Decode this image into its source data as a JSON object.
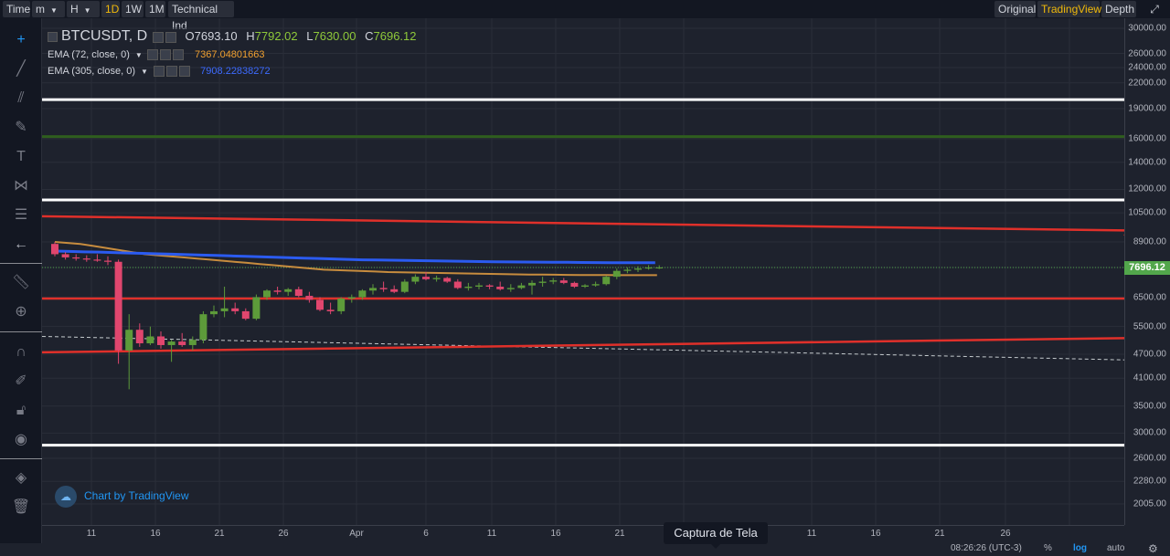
{
  "toolbar": {
    "time_label": "Time",
    "minutes_label": "m",
    "hours_label": "H",
    "day_label": "1D",
    "week_label": "1W",
    "month_label": "1M",
    "indicators_label": "Technical Ind",
    "original_label": "Original",
    "tradingview_label": "TradingView",
    "depth_label": "Depth"
  },
  "legend": {
    "symbol": "BTCUSDT, D",
    "open_label": "O",
    "open_value": "7693.10",
    "high_label": "H",
    "high_value": "7792.02",
    "low_label": "L",
    "low_value": "7630.00",
    "close_label": "C",
    "close_value": "7696.12",
    "ema1_label": "EMA (72, close, 0)",
    "ema1_value": "7367.04801663",
    "ema2_label": "EMA (305, close, 0)",
    "ema2_value": "7908.22838272"
  },
  "colors": {
    "up": "#5d9b3a",
    "down": "#e0466e",
    "ema72": "#c78c3e",
    "ema305": "#2b5bf0",
    "trendline": "#e0302a",
    "hline_white": "#ffffff",
    "hline_green": "#2f5e1e",
    "open_value": "#d1d4dc",
    "accent": "#f0b90b"
  },
  "price_axis": {
    "labels": [
      "30000.00",
      "26000.00",
      "24000.00",
      "22000.00",
      "19000.00",
      "16000.00",
      "14000.00",
      "12000.00",
      "10500.00",
      "8900.00",
      "7696.12",
      "6500.00",
      "5500.00",
      "4700.00",
      "4100.00",
      "3500.00",
      "3000.00",
      "2600.00",
      "2280.00",
      "2005.00"
    ],
    "current_price": "7696.12"
  },
  "time_axis": {
    "labels": [
      "11",
      "16",
      "21",
      "26",
      "Apr",
      "6",
      "11",
      "16",
      "21",
      "6",
      "11",
      "16",
      "21",
      "26"
    ]
  },
  "watermark": "Chart by TradingView",
  "tooltip": "Captura de Tela",
  "bottom": {
    "clock": "08:26:26 (UTC-3)",
    "percent": "%",
    "log": "log",
    "auto": "auto"
  },
  "tools": [
    "crosshair-icon",
    "trendline-icon",
    "fib-icon",
    "brush-icon",
    "text-icon",
    "pattern-icon",
    "prediction-icon",
    "back-arrow-icon",
    "ruler-icon",
    "zoom-in-icon",
    "magnet-icon",
    "lock-drawing-icon",
    "unlock-icon",
    "eye-icon",
    "layers-icon",
    "trash-icon"
  ],
  "chart_data": {
    "type": "candlestick",
    "interval": "D",
    "scale": "log",
    "candles": [
      {
        "o": 8800,
        "h": 8900,
        "l": 8200,
        "c": 8300
      },
      {
        "o": 8300,
        "h": 8400,
        "l": 8050,
        "c": 8150
      },
      {
        "o": 8150,
        "h": 8300,
        "l": 8000,
        "c": 8100
      },
      {
        "o": 8100,
        "h": 8250,
        "l": 7950,
        "c": 8050
      },
      {
        "o": 8050,
        "h": 8300,
        "l": 7950,
        "c": 8000
      },
      {
        "o": 8000,
        "h": 8200,
        "l": 7800,
        "c": 7950
      },
      {
        "o": 7950,
        "h": 8050,
        "l": 4450,
        "c": 4800
      },
      {
        "o": 4800,
        "h": 5900,
        "l": 3850,
        "c": 5400
      },
      {
        "o": 5400,
        "h": 5600,
        "l": 4900,
        "c": 5000
      },
      {
        "o": 5000,
        "h": 5500,
        "l": 4950,
        "c": 5200
      },
      {
        "o": 5200,
        "h": 5350,
        "l": 4850,
        "c": 4950
      },
      {
        "o": 4950,
        "h": 5100,
        "l": 4500,
        "c": 5050
      },
      {
        "o": 5050,
        "h": 5300,
        "l": 4900,
        "c": 4950
      },
      {
        "o": 4950,
        "h": 5200,
        "l": 4800,
        "c": 5100
      },
      {
        "o": 5100,
        "h": 6000,
        "l": 5000,
        "c": 5900
      },
      {
        "o": 5900,
        "h": 6200,
        "l": 5800,
        "c": 6000
      },
      {
        "o": 6000,
        "h": 6900,
        "l": 5800,
        "c": 6100
      },
      {
        "o": 6100,
        "h": 6300,
        "l": 5900,
        "c": 6000
      },
      {
        "o": 6000,
        "h": 6100,
        "l": 5700,
        "c": 5750
      },
      {
        "o": 5750,
        "h": 6600,
        "l": 5700,
        "c": 6500
      },
      {
        "o": 6500,
        "h": 6800,
        "l": 6400,
        "c": 6750
      },
      {
        "o": 6750,
        "h": 6900,
        "l": 6600,
        "c": 6700
      },
      {
        "o": 6700,
        "h": 6850,
        "l": 6550,
        "c": 6800
      },
      {
        "o": 6800,
        "h": 6900,
        "l": 6500,
        "c": 6550
      },
      {
        "o": 6550,
        "h": 6700,
        "l": 6300,
        "c": 6400
      },
      {
        "o": 6400,
        "h": 6500,
        "l": 6000,
        "c": 6050
      },
      {
        "o": 6050,
        "h": 6300,
        "l": 5900,
        "c": 6000
      },
      {
        "o": 6000,
        "h": 6500,
        "l": 5900,
        "c": 6450
      },
      {
        "o": 6450,
        "h": 6600,
        "l": 6300,
        "c": 6500
      },
      {
        "o": 6500,
        "h": 6800,
        "l": 6400,
        "c": 6750
      },
      {
        "o": 6750,
        "h": 7000,
        "l": 6600,
        "c": 6850
      },
      {
        "o": 6850,
        "h": 7100,
        "l": 6700,
        "c": 6800
      },
      {
        "o": 6800,
        "h": 6950,
        "l": 6650,
        "c": 6700
      },
      {
        "o": 6700,
        "h": 7200,
        "l": 6650,
        "c": 7100
      },
      {
        "o": 7100,
        "h": 7400,
        "l": 7000,
        "c": 7300
      },
      {
        "o": 7300,
        "h": 7500,
        "l": 7150,
        "c": 7200
      },
      {
        "o": 7200,
        "h": 7350,
        "l": 7100,
        "c": 7250
      },
      {
        "o": 7250,
        "h": 7300,
        "l": 7050,
        "c": 7100
      },
      {
        "o": 7100,
        "h": 7200,
        "l": 6800,
        "c": 6850
      },
      {
        "o": 6850,
        "h": 7050,
        "l": 6750,
        "c": 6900
      },
      {
        "o": 6900,
        "h": 7050,
        "l": 6800,
        "c": 6950
      },
      {
        "o": 6950,
        "h": 7000,
        "l": 6800,
        "c": 6900
      },
      {
        "o": 6900,
        "h": 7100,
        "l": 6750,
        "c": 6800
      },
      {
        "o": 6800,
        "h": 7000,
        "l": 6700,
        "c": 6850
      },
      {
        "o": 6850,
        "h": 7050,
        "l": 6800,
        "c": 6950
      },
      {
        "o": 6950,
        "h": 7150,
        "l": 6600,
        "c": 7050
      },
      {
        "o": 7050,
        "h": 7300,
        "l": 6900,
        "c": 7100
      },
      {
        "o": 7100,
        "h": 7250,
        "l": 7000,
        "c": 7150
      },
      {
        "o": 7150,
        "h": 7250,
        "l": 7000,
        "c": 7050
      },
      {
        "o": 7050,
        "h": 7100,
        "l": 6850,
        "c": 6900
      },
      {
        "o": 6900,
        "h": 7000,
        "l": 6850,
        "c": 6950
      },
      {
        "o": 6950,
        "h": 7100,
        "l": 6900,
        "c": 7000
      },
      {
        "o": 7000,
        "h": 7350,
        "l": 6950,
        "c": 7300
      },
      {
        "o": 7300,
        "h": 7650,
        "l": 7200,
        "c": 7550
      },
      {
        "o": 7550,
        "h": 7700,
        "l": 7450,
        "c": 7600
      },
      {
        "o": 7600,
        "h": 7750,
        "l": 7500,
        "c": 7650
      },
      {
        "o": 7650,
        "h": 7800,
        "l": 7600,
        "c": 7693
      },
      {
        "o": 7693.1,
        "h": 7792.02,
        "l": 7630,
        "c": 7696.12
      }
    ],
    "ema72": [
      8900,
      8850,
      8800,
      8700,
      8600,
      8500,
      8400,
      8300,
      8250,
      8200,
      8150,
      8100,
      8050,
      8000,
      7950,
      7900,
      7850,
      7800,
      7750,
      7700,
      7650,
      7600,
      7580,
      7560,
      7540,
      7520,
      7500,
      7490,
      7480,
      7470,
      7460,
      7450,
      7440,
      7430,
      7420,
      7410,
      7400,
      7395,
      7390,
      7385,
      7380,
      7375,
      7372,
      7370,
      7368,
      7367,
      7367,
      7367
    ],
    "ema305": [
      8450,
      8430,
      8410,
      8400,
      8380,
      8360,
      8340,
      8320,
      8300,
      8280,
      8260,
      8240,
      8220,
      8200,
      8180,
      8160,
      8140,
      8120,
      8100,
      8080,
      8060,
      8040,
      8030,
      8020,
      8010,
      8000,
      7990,
      7980,
      7970,
      7960,
      7950,
      7945,
      7940,
      7935,
      7930,
      7925,
      7920,
      7915,
      7912,
      7910,
      7909,
      7908.2
    ],
    "horizontal_levels": {
      "white": [
        20000,
        11300,
        2800
      ],
      "green": [
        16200
      ],
      "red": [
        6450
      ]
    },
    "trendlines": [
      {
        "from": [
          0,
          10300
        ],
        "to": [
          100,
          9500
        ]
      },
      {
        "from": [
          0,
          4750
        ],
        "to": [
          100,
          5150
        ]
      },
      {
        "from": [
          19,
          4750
        ],
        "to": [
          100,
          9300
        ]
      }
    ],
    "dashed_line": {
      "from": [
        0,
        5200
      ],
      "to": [
        100,
        4550
      ]
    }
  }
}
